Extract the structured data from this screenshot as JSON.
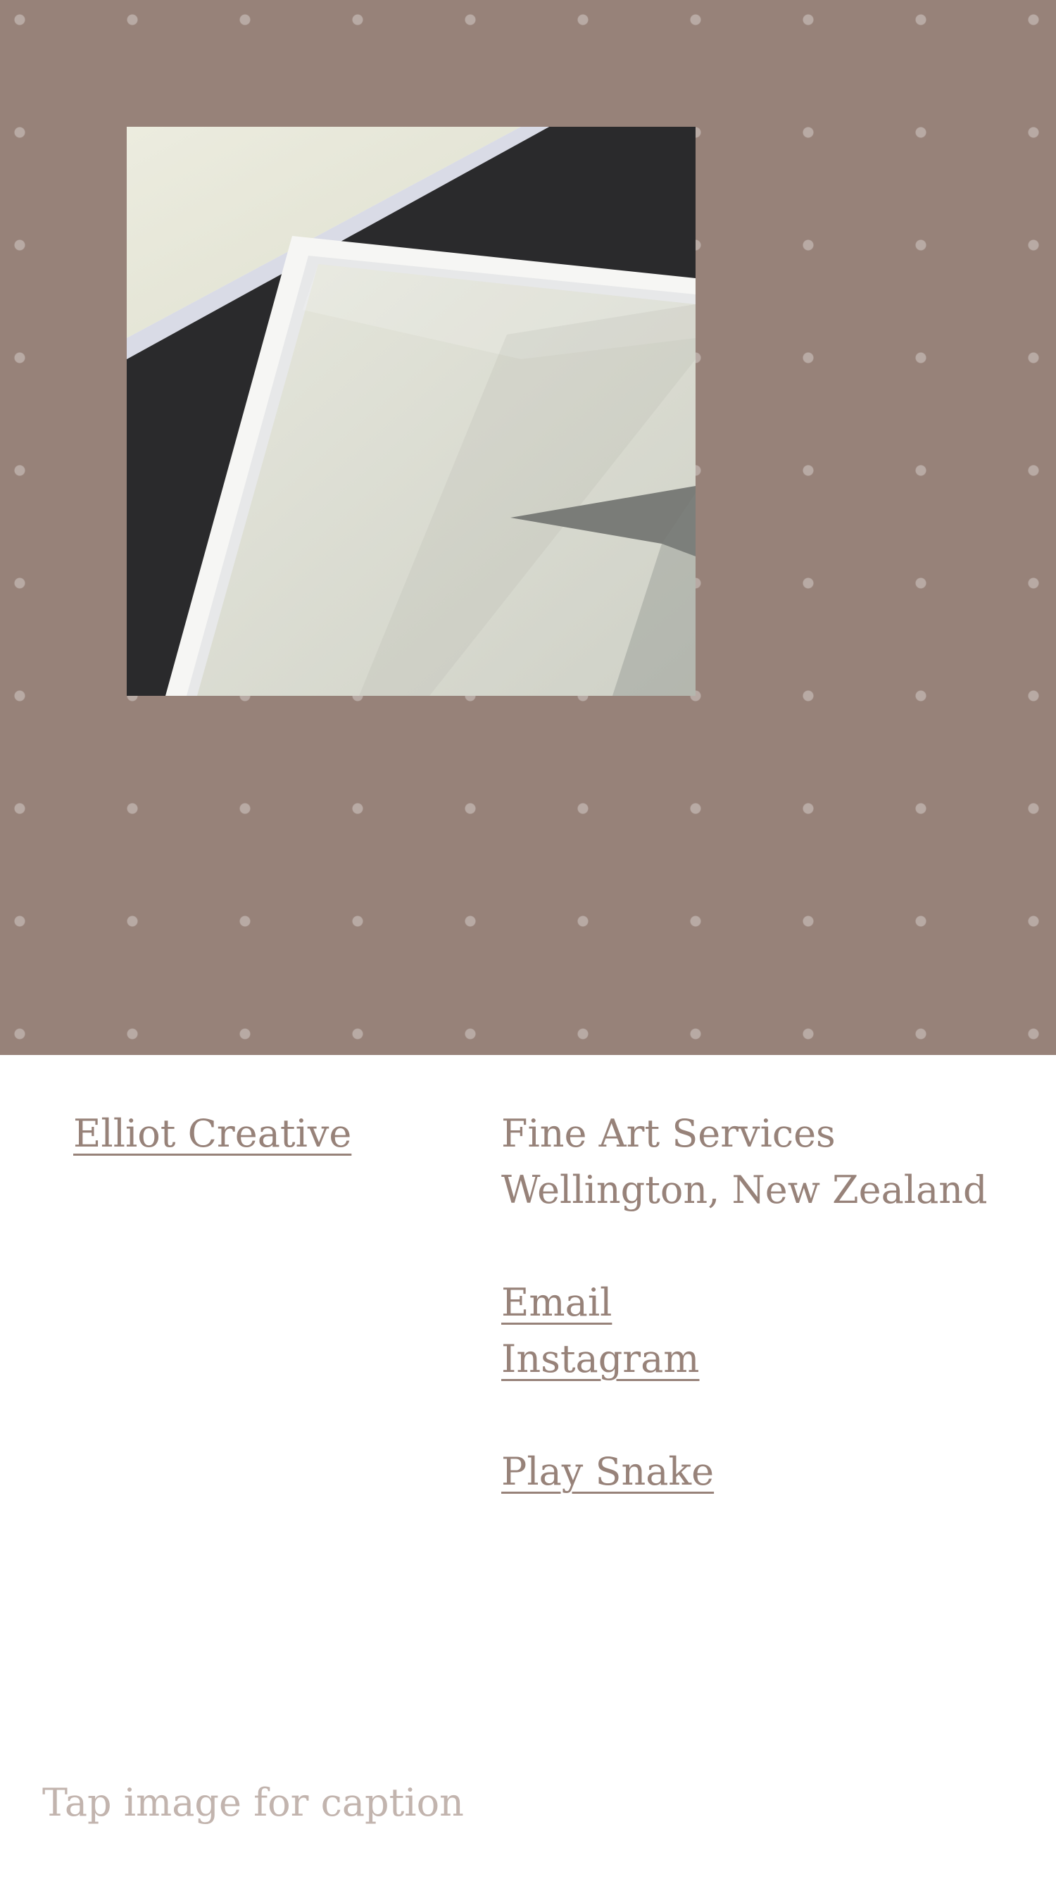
{
  "hero": {
    "background_color": "#978279",
    "photo_description": "white frames",
    "photo_icon": "framed-artwork-photo"
  },
  "footer": {
    "brand_link": "Elliot Creative",
    "services": "Fine Art Services",
    "location": "Wellington, New Zealand",
    "email_link": "Email",
    "instagram_link": "Instagram",
    "snake_link": "Play Snake"
  },
  "caption_hint": "Tap image for caption",
  "colors": {
    "text": "#978279",
    "hint": "#c2b4ae",
    "background": "#ffffff"
  }
}
